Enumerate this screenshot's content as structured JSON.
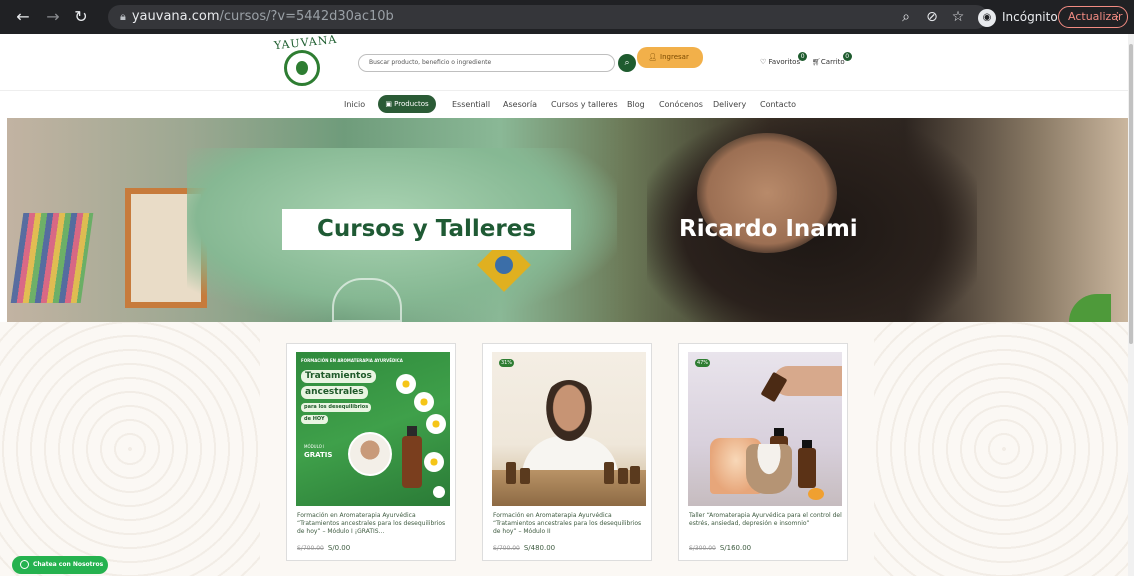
{
  "browser": {
    "url_domain": "yauvana.com",
    "url_path": "/cursos/?v=5442d30ac10b",
    "incognito_label": "Incógnito",
    "update_label": "Actualizar"
  },
  "header": {
    "logo_text": "YAUVANA",
    "search_placeholder": "Buscar producto, beneficio o ingrediente",
    "login_label": "Ingresar",
    "favorites_label": "Favoritos",
    "favorites_count": "0",
    "cart_label": "Carrito",
    "cart_count": "0"
  },
  "nav": {
    "items": [
      "Inicio",
      "Productos",
      "Essentiall",
      "Asesoría",
      "Cursos y talleres",
      "Blog",
      "Conócenos",
      "Delivery",
      "Contacto"
    ]
  },
  "hero": {
    "title": "Cursos y Talleres",
    "name": "Ricardo Inami"
  },
  "products": [
    {
      "title": "Formación en Aromaterapia Ayurvédica “Tratamientos ancestrales para los desequilibrios de hoy” – Módulo I ¡GRATIS...",
      "old_price": "S/700.00",
      "price": "S/0.00",
      "badge": "",
      "image_text": {
        "kicker": "FORMACIÓN EN AROMATERAPIA AYURVÉDICA",
        "line1": "Tratamientos",
        "line2": "ancestrales",
        "line3": "para los desequilibrios",
        "line4": "de HOY",
        "modulo": "MÓDULO I",
        "gratis": "GRATIS"
      }
    },
    {
      "title": "Formación en Aromaterapia Ayurvédica “Tratamientos ancestrales para los desequilibrios de hoy” – Módulo II",
      "old_price": "S/700.00",
      "price": "S/480.00",
      "badge": "31%"
    },
    {
      "title": "Taller “Aromaterapia Ayurvédica para el control del estrés, ansiedad, depresión e insomnio”",
      "old_price": "S/300.00",
      "price": "S/160.00",
      "badge": "47%"
    }
  ],
  "chat": {
    "label": "Chatea con Nosotros"
  },
  "colors": {
    "brand_green": "#1f5a34",
    "accent_orange": "#f2b04a",
    "whatsapp_green": "#25b24f"
  }
}
